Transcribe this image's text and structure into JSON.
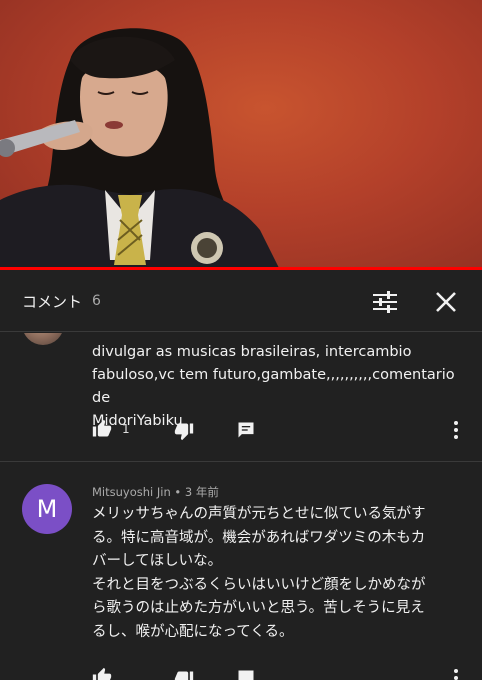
{
  "video": {
    "progress_fraction": 1.0,
    "progress_color": "#ff0000"
  },
  "comments_panel": {
    "title": "コメント",
    "count": "6",
    "filter_icon": "sort-filter-icon",
    "close_icon": "close-icon"
  },
  "comments": [
    {
      "text_lines": [
        "divulgar as musicas brasileiras, intercambio",
        "fabuloso,vc tem futuro,gambate,,,,,,,,,,comentario de",
        "MidoriYabiku"
      ],
      "like_count": "1"
    },
    {
      "avatar_letter": "M",
      "avatar_color": "#7b4fc6",
      "author": "Mitsuyoshi Jin",
      "separator": "•",
      "time": "3 年前",
      "text_lines": [
        "メリッサちゃんの声質が元ちとせに似ている気がす",
        "る。特に高音域が。機会があればワダツミの木もカ",
        "バーしてほしいな。",
        "それと目をつぶるくらいはいいけど顔をしかめなが",
        "ら歌うのは止めた方がいいと思う。苦しそうに見え",
        "るし、喉が心配になってくる。"
      ]
    }
  ]
}
